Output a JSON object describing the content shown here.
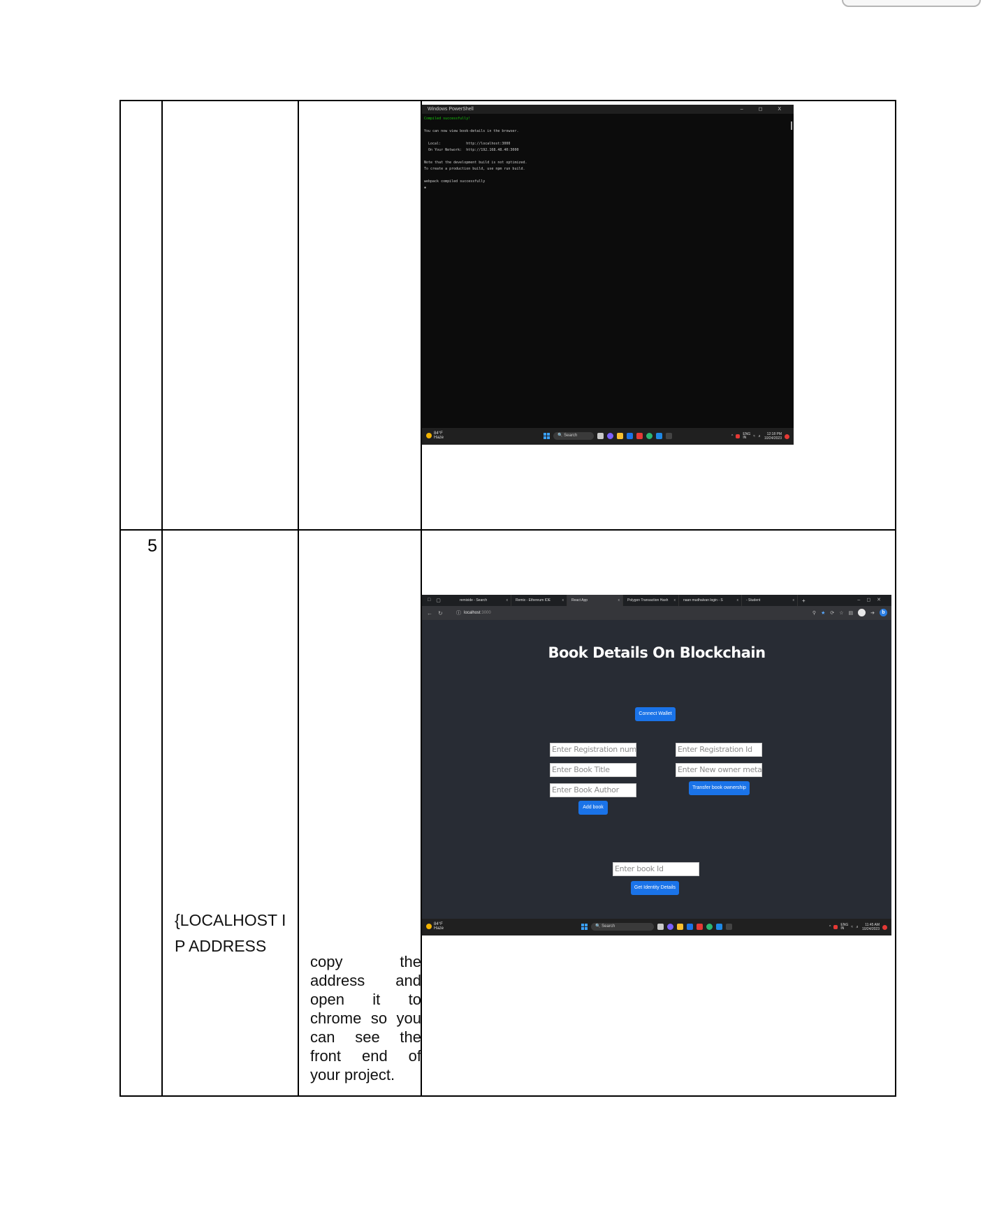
{
  "rows": [
    {
      "number": "",
      "col2": "",
      "col3": "",
      "terminal": {
        "title": "Windows PowerShell",
        "window_controls": "– ◻ X",
        "lines": [
          {
            "text": "Compiled successfully!",
            "color": "green"
          },
          {
            "text": "",
            "color": "default"
          },
          {
            "text": "You can now view book-details in the browser.",
            "color": "default"
          },
          {
            "text": "",
            "color": "default"
          },
          {
            "text": "  Local:            http://localhost:3000",
            "color": "default"
          },
          {
            "text": "  On Your Network:  http://192.168.48.40:3000",
            "color": "default"
          },
          {
            "text": "",
            "color": "default"
          },
          {
            "text": "Note that the development build is not optimized.",
            "color": "default"
          },
          {
            "text": "To create a production build, use npm run build.",
            "color": "default"
          },
          {
            "text": "",
            "color": "default"
          },
          {
            "text": "webpack compiled successfully",
            "color": "default"
          },
          {
            "text": "▪",
            "color": "default"
          }
        ],
        "taskbar": {
          "weather_temp": "84°F",
          "weather_desc": "Haze",
          "search_label": "Search",
          "lang": "ENG\nIN",
          "time": "12:18 PM",
          "date": "10/24/2023"
        }
      }
    },
    {
      "number": "5",
      "col2": "{LOCALHOST IP ADDRESS",
      "col3": "copy the address and open it to chrome so you can see the front end of your project.",
      "browser": {
        "tabs": [
          {
            "label": "remixide - Search",
            "active": false
          },
          {
            "label": "Remix - Ethereum IDE",
            "active": false
          },
          {
            "label": "React App",
            "active": true
          },
          {
            "label": "Polygon Transaction Hash",
            "active": false
          },
          {
            "label": "naan mudhalvan login - S",
            "active": false
          },
          {
            "label": "- Student",
            "active": false
          }
        ],
        "url_host": "localhost",
        "url_port": ":3000",
        "app_title": "Book Details On Blockchain",
        "connect_wallet": "Connect Wallet",
        "placeholders": {
          "registration_number": "Enter Registration numb",
          "book_title": "Enter Book Title",
          "book_author": "Enter Book Author",
          "registration_id": "Enter Registration Id",
          "new_owner": "Enter New owner metama",
          "book_id": "Enter book Id"
        },
        "buttons": {
          "add_book": "Add book",
          "transfer": "Transfer book ownership",
          "get_identity": "Get Identity Details"
        },
        "taskbar": {
          "weather_temp": "84°F",
          "weather_desc": "Haze",
          "search_label": "Search",
          "lang": "ENG\nIN",
          "time": "11:45 AM",
          "date": "10/24/2023"
        }
      }
    }
  ]
}
